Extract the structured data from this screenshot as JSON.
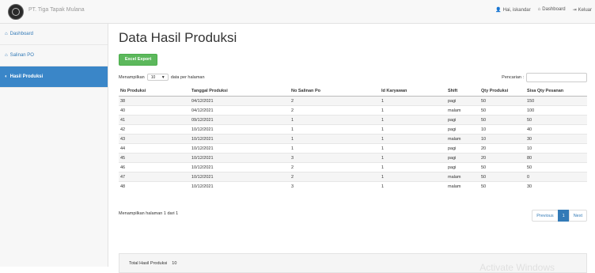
{
  "app": {
    "brand": "PT. Tiga Tapak Mulana"
  },
  "topnav": [
    {
      "icon": "user-icon",
      "glyph": "👤",
      "label": "Hai, iskandar"
    },
    {
      "icon": "home-icon",
      "glyph": "⌂",
      "label": "Dashboard"
    },
    {
      "icon": "logout-icon",
      "glyph": "⇥",
      "label": "Keluar"
    }
  ],
  "sidebar": {
    "items": [
      {
        "icon": "home-icon",
        "glyph": "⌂",
        "label": "Dashboard",
        "active": false
      },
      {
        "icon": "home-icon",
        "glyph": "⌂",
        "label": "Salinan PO",
        "active": false
      },
      {
        "icon": "chart-icon",
        "glyph": "◐",
        "label": "Hasil Produksi",
        "active": true
      }
    ]
  },
  "page": {
    "title": "Data Hasil Produksi",
    "excel_button": "Excel Export",
    "length": {
      "prefix": "Menampilkan",
      "value": "10",
      "suffix": "data per halaman"
    },
    "search_label": "Pencarian :",
    "info": "Menampilkan halaman 1 dari 1",
    "pagination": {
      "previous": "Previous",
      "current": "1",
      "next": "Next"
    }
  },
  "table": {
    "columns": [
      "No Produksi",
      "Tanggal Produksi",
      "No Salinan Po",
      "Id Karyawan",
      "Shift",
      "Qty Produksi",
      "Sisa Qty Pesanan"
    ],
    "rows": [
      [
        "38",
        "04/12/2021",
        "2",
        "1",
        "pagi",
        "50",
        "150"
      ],
      [
        "40",
        "04/12/2021",
        "2",
        "1",
        "malam",
        "50",
        "100"
      ],
      [
        "41",
        "09/12/2021",
        "1",
        "1",
        "pagi",
        "50",
        "50"
      ],
      [
        "42",
        "10/12/2021",
        "1",
        "1",
        "pagi",
        "10",
        "40"
      ],
      [
        "43",
        "10/12/2021",
        "1",
        "1",
        "malam",
        "10",
        "30"
      ],
      [
        "44",
        "10/12/2021",
        "1",
        "1",
        "pagi",
        "20",
        "10"
      ],
      [
        "45",
        "10/12/2021",
        "3",
        "1",
        "pagi",
        "20",
        "80"
      ],
      [
        "46",
        "10/12/2021",
        "2",
        "1",
        "pagi",
        "50",
        "50"
      ],
      [
        "47",
        "10/12/2021",
        "2",
        "1",
        "malam",
        "50",
        "0"
      ],
      [
        "48",
        "10/12/2021",
        "3",
        "1",
        "malam",
        "50",
        "30"
      ]
    ]
  },
  "footer": {
    "label": "Total Hasil Produksi",
    "value": "10"
  },
  "watermark": "Activate Windows"
}
